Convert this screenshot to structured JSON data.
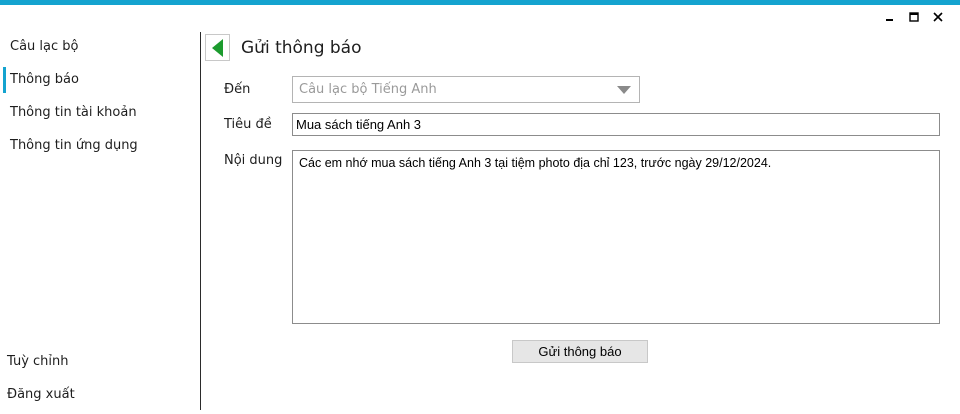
{
  "sidebar": {
    "items": [
      {
        "label": "Câu lạc bộ"
      },
      {
        "label": "Thông báo"
      },
      {
        "label": "Thông tin tài khoản"
      },
      {
        "label": "Thông tin ứng dụng"
      }
    ],
    "bottom": [
      {
        "label": "Tuỳ chỉnh"
      },
      {
        "label": "Đăng xuất"
      }
    ]
  },
  "main": {
    "title": "Gửi thông báo",
    "to_label": "Đến",
    "to_value": "Câu lạc bộ Tiếng Anh",
    "subject_label": "Tiêu đề",
    "subject_value": "Mua sách tiếng Anh 3",
    "content_label": "Nội dung",
    "content_value": "Các em nhớ mua sách tiếng Anh 3 tại tiệm photo địa chỉ 123, trước ngày 29/12/2024.",
    "submit_label": "Gửi thông báo"
  },
  "colors": {
    "accent": "#14a3cf",
    "back_arrow": "#1c9b2e"
  },
  "icons": {
    "minimize": "minimize-icon",
    "maximize": "maximize-icon",
    "close": "close-icon",
    "back": "back-arrow-icon",
    "dropdown": "chevron-down-icon"
  }
}
